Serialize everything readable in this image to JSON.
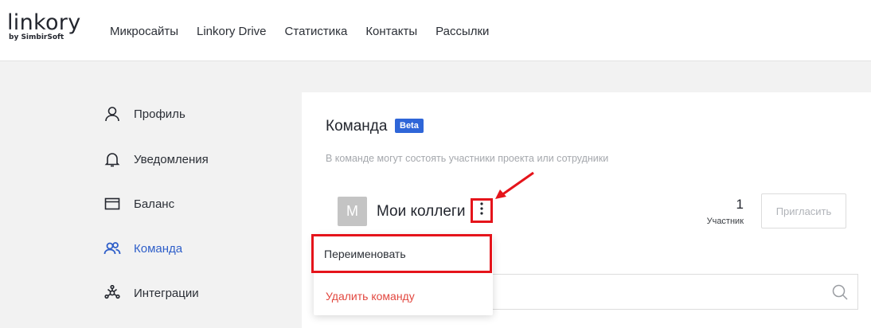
{
  "brand": {
    "logo": "linkory",
    "sub": "by SimbirSoft"
  },
  "nav": [
    "Микросайты",
    "Linkory Drive",
    "Статистика",
    "Контакты",
    "Рассылки"
  ],
  "sidebar": {
    "items": [
      {
        "label": "Профиль",
        "icon": "user-icon"
      },
      {
        "label": "Уведомления",
        "icon": "bell-icon"
      },
      {
        "label": "Баланс",
        "icon": "wallet-icon"
      },
      {
        "label": "Команда",
        "icon": "team-icon",
        "active": true
      },
      {
        "label": "Интеграции",
        "icon": "integrations-icon"
      }
    ]
  },
  "team": {
    "title": "Команда",
    "badge": "Beta",
    "hint": "В команде могут состоять участники проекта или сотрудники",
    "avatar_letter": "М",
    "name": "Мои коллеги",
    "members_count": "1",
    "members_label": "Участник",
    "invite_label": "Пригласить"
  },
  "menu": {
    "rename": "Переименовать",
    "delete": "Удалить команду"
  },
  "colors": {
    "accent": "#2f66d8",
    "highlight": "#e5141b",
    "danger": "#e2473f"
  }
}
